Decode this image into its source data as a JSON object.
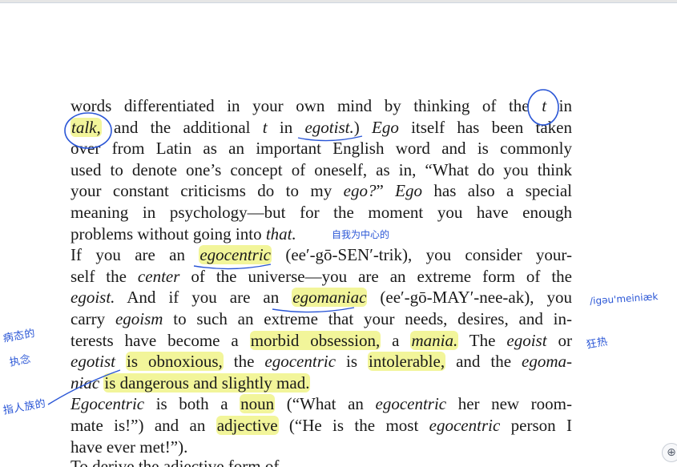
{
  "page": {
    "lines": [
      {
        "parts": [
          {
            "t": "words differentiated in your own mind by thinking of the "
          },
          {
            "t": "t",
            "i": true
          },
          {
            "t": " in"
          }
        ]
      },
      {
        "parts": [
          {
            "t": "talk,",
            "i": true,
            "hl": true
          },
          {
            "t": " and the additional "
          },
          {
            "t": "t",
            "i": true
          },
          {
            "t": " in "
          },
          {
            "t": "egotist.",
            "i": true
          },
          {
            "t": ") "
          },
          {
            "t": "Ego",
            "i": true
          },
          {
            "t": " itself has been taken"
          }
        ]
      },
      {
        "parts": [
          {
            "t": "over from Latin as an important English word and is commonly"
          }
        ]
      },
      {
        "parts": [
          {
            "t": "used to denote one’s concept of oneself, as in, “What do you think"
          }
        ]
      },
      {
        "parts": [
          {
            "t": "your constant criticisms do to my "
          },
          {
            "t": "ego?",
            "i": true
          },
          {
            "t": "” "
          },
          {
            "t": "Ego",
            "i": true
          },
          {
            "t": " has also a special"
          }
        ]
      },
      {
        "parts": [
          {
            "t": "meaning in psychology—but for the moment you have enough"
          }
        ]
      },
      {
        "parts": [
          {
            "t": "problems without going into "
          },
          {
            "t": "that.",
            "i": true
          }
        ],
        "nojustify": true
      },
      {
        "parts": [
          {
            "t": "    If you are an "
          },
          {
            "t": "egocentric",
            "i": true,
            "hl": true
          },
          {
            "t": " (ee′-gō-SEN′-trik), you consider your-"
          }
        ]
      },
      {
        "parts": [
          {
            "t": "self the "
          },
          {
            "t": "center",
            "i": true
          },
          {
            "t": " of the universe—you are an extreme form of the"
          }
        ]
      },
      {
        "parts": [
          {
            "t": "egoist.",
            "i": true
          },
          {
            "t": " And if you are an "
          },
          {
            "t": "egomaniac",
            "i": true,
            "hl": true
          },
          {
            "t": " (ee′-gō-MAY′-nee-ak), you"
          }
        ]
      },
      {
        "parts": [
          {
            "t": "carry "
          },
          {
            "t": "egoism",
            "i": true
          },
          {
            "t": " to such an extreme that your needs, desires, and in-"
          }
        ]
      },
      {
        "parts": [
          {
            "t": "terests have become a "
          },
          {
            "t": "morbid obsession,",
            "hl": true
          },
          {
            "t": " a "
          },
          {
            "t": "mania.",
            "i": true,
            "hl": true
          },
          {
            "t": " The "
          },
          {
            "t": "egoist",
            "i": true
          },
          {
            "t": " or"
          }
        ]
      },
      {
        "parts": [
          {
            "t": "egotist",
            "i": true
          },
          {
            "t": " "
          },
          {
            "t": "is obnoxious,",
            "hl": true
          },
          {
            "t": " the "
          },
          {
            "t": "egocentric",
            "i": true
          },
          {
            "t": " is "
          },
          {
            "t": "intolerable,",
            "hl": true
          },
          {
            "t": " and the "
          },
          {
            "t": "egoma-",
            "i": true
          }
        ]
      },
      {
        "parts": [
          {
            "t": "niac",
            "i": true
          },
          {
            "t": " "
          },
          {
            "t": "is dangerous and slightly mad.",
            "hl": true
          }
        ],
        "nojustify": true
      },
      {
        "parts": [
          {
            "t": "    "
          },
          {
            "t": "Egocentric",
            "i": true
          },
          {
            "t": " is both a "
          },
          {
            "t": "noun",
            "hl": true
          },
          {
            "t": " (“What an "
          },
          {
            "t": "egocentric",
            "i": true
          },
          {
            "t": " her new room-"
          }
        ]
      },
      {
        "parts": [
          {
            "t": "mate is!”) and an "
          },
          {
            "t": "adjective",
            "hl": true
          },
          {
            "t": " (“He is the most "
          },
          {
            "t": "egocentric",
            "i": true
          },
          {
            "t": " person I"
          }
        ]
      },
      {
        "parts": [
          {
            "t": "have ever met!”)."
          }
        ],
        "nojustify": true
      }
    ],
    "cut_line": "To derive the adjective form of"
  },
  "annotations": {
    "self_centered_cn": "自我为中心的",
    "pronunciation": "/igəu'meiniæk",
    "mania_cn": "狂热",
    "morbid_cn_line1": "病态的",
    "morbid_cn_line2": "执念",
    "noun_cn": "指人族的"
  },
  "widget": {
    "zoom_symbol": "⊕"
  },
  "colors": {
    "ink": "#2a56d6",
    "highlight": "#eef278"
  }
}
